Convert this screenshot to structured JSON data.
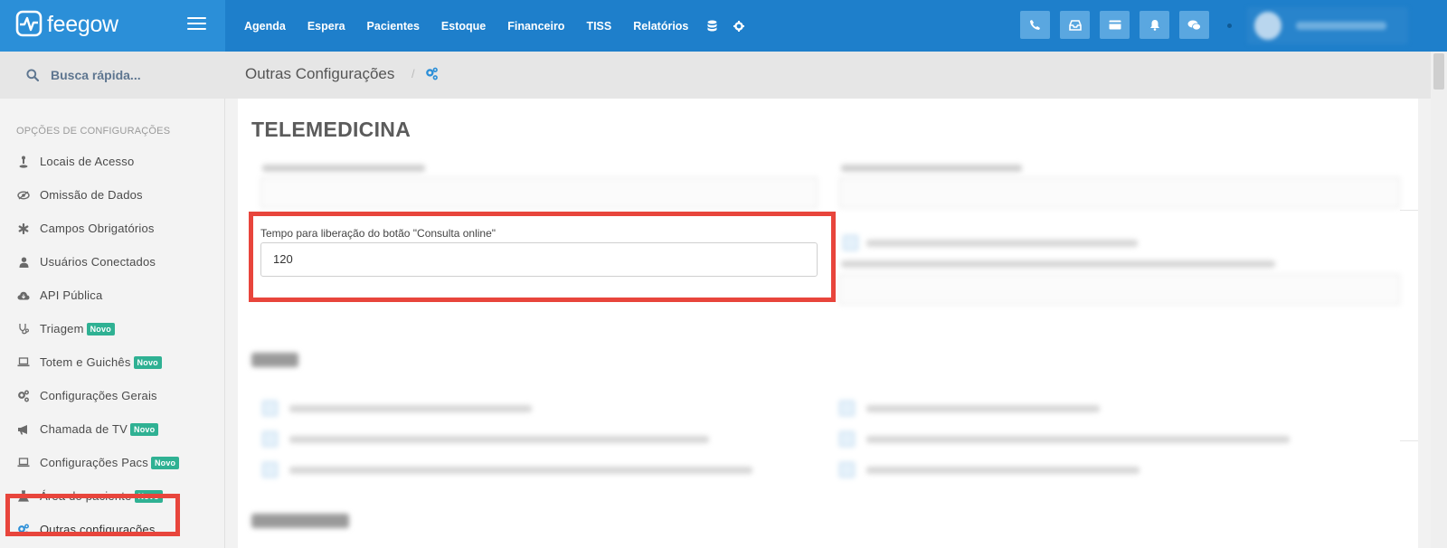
{
  "brand": {
    "name": "feegow"
  },
  "topnav": {
    "items": [
      "Agenda",
      "Espera",
      "Pacientes",
      "Estoque",
      "Financeiro",
      "TISS",
      "Relatórios"
    ],
    "icons": [
      "database-icon",
      "gear-icon"
    ]
  },
  "top_actions": [
    "phone-icon",
    "inbox-icon",
    "card-icon",
    "bell-icon",
    "chat-icon"
  ],
  "search": {
    "placeholder": "Busca rápida..."
  },
  "sidebar": {
    "section_title": "OPÇÕES DE CONFIGURAÇÕES",
    "items": [
      {
        "label": "Locais de Acesso",
        "icon": "location-icon",
        "badge": ""
      },
      {
        "label": "Omissão de Dados",
        "icon": "eye-slash-icon",
        "badge": ""
      },
      {
        "label": "Campos Obrigatórios",
        "icon": "asterisk-icon",
        "badge": ""
      },
      {
        "label": "Usuários Conectados",
        "icon": "user-icon",
        "badge": ""
      },
      {
        "label": "API Pública",
        "icon": "cloud-icon",
        "badge": ""
      },
      {
        "label": "Triagem",
        "icon": "stethoscope-icon",
        "badge": "Novo"
      },
      {
        "label": "Totem e Guichês",
        "icon": "laptop-icon",
        "badge": "Novo"
      },
      {
        "label": "Configurações Gerais",
        "icon": "cogs-icon",
        "badge": ""
      },
      {
        "label": "Chamada de TV",
        "icon": "bullhorn-icon",
        "badge": "Novo"
      },
      {
        "label": "Configurações Pacs",
        "icon": "laptop-icon",
        "badge": "Novo"
      },
      {
        "label": "Área do paciente",
        "icon": "flask-icon",
        "badge": "Novo"
      },
      {
        "label": "Outras configurações",
        "icon": "cogs-icon",
        "badge": ""
      }
    ]
  },
  "breadcrumb": {
    "title": "Outras Configurações",
    "separator": "/"
  },
  "main": {
    "section_title": "TELEMEDICINA",
    "release_field": {
      "label": "Tempo para liberação do botão \"Consulta online\"",
      "value": "120"
    }
  },
  "colors": {
    "topbar": "#1e7fcb",
    "brand_panel": "#2b8fd8",
    "highlight": "#e8453c",
    "badge": "#2fb193"
  }
}
